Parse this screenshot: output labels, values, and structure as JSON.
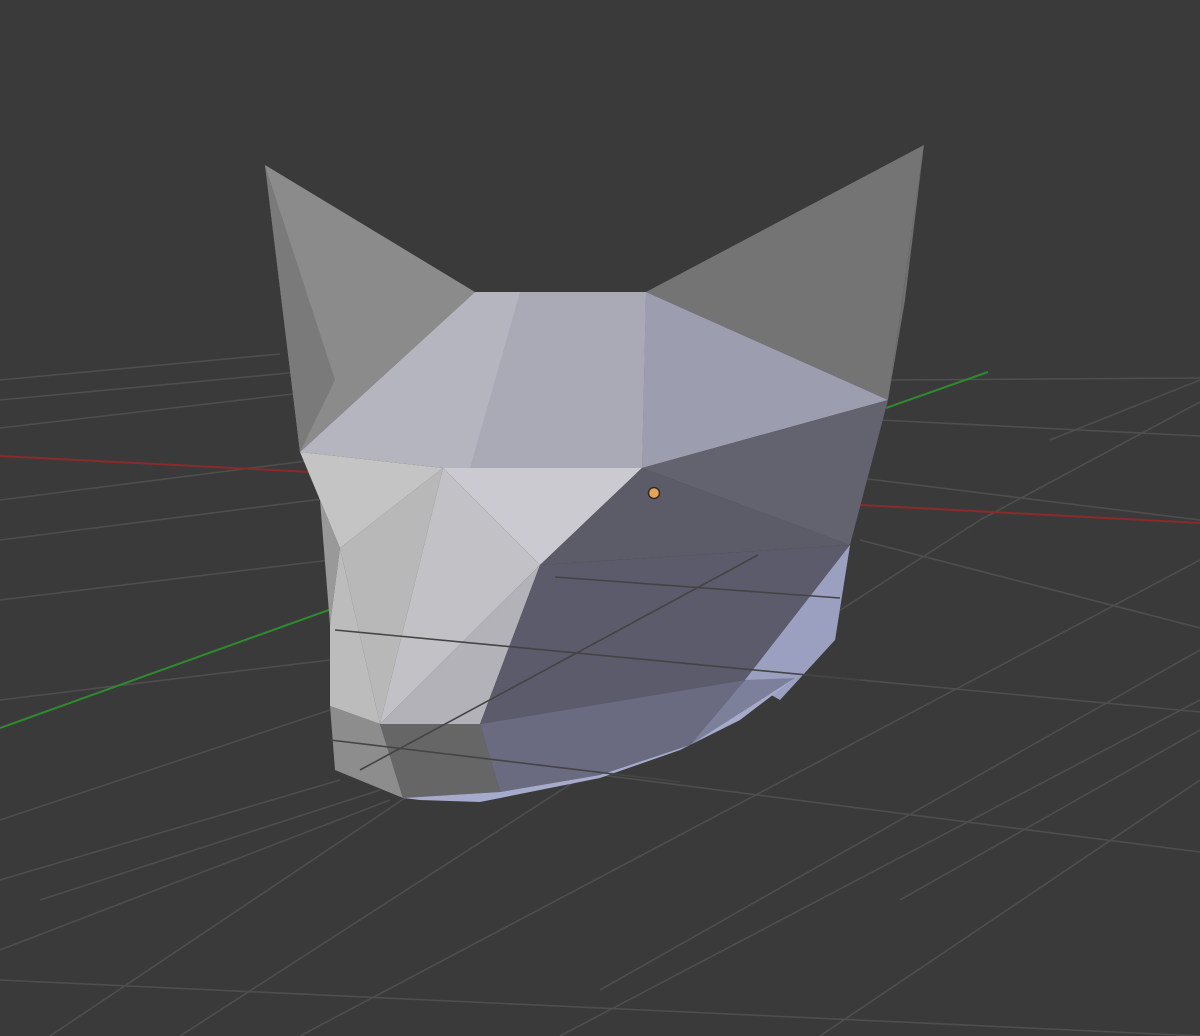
{
  "viewport": {
    "background": "#3a3a3a",
    "grid_color": "#4e4e4e",
    "x_axis_color": "#8a2a2a",
    "y_axis_color": "#2f8a2f",
    "object_origin_color": "#e8a256",
    "object_name": "cat-head-mesh",
    "view_mode": "solid",
    "grid_visible": true
  }
}
